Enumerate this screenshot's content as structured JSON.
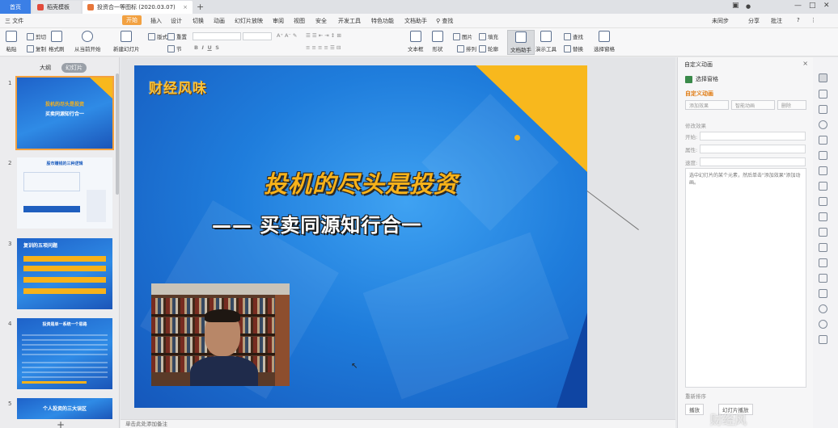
{
  "tabs": {
    "home": "首页",
    "tab1": "稻壳模板",
    "tab2": "投资合一等图标 (2020.03.07)",
    "new_tab": "+"
  },
  "menus": {
    "file": "三 文件",
    "items": [
      "开始",
      "插入",
      "设计",
      "切换",
      "动画",
      "幻灯片放映",
      "审阅",
      "视图",
      "安全",
      "开发工具",
      "特色功能",
      "文档助手"
    ],
    "search": "查找",
    "right": [
      "未同步",
      "分享",
      "批注"
    ]
  },
  "ribbon": {
    "paste": "粘贴",
    "cut": "剪切",
    "copy": "复制",
    "format_painter": "格式刷",
    "from_current": "从当前开始",
    "new_slide": "新建幻灯片",
    "layout": "版式",
    "section": "节",
    "reset": "重置",
    "textbox": "文本框",
    "shape": "形状",
    "arrange": "排列",
    "picture": "图片",
    "outline": "轮廓",
    "fill": "填充",
    "text_assist": "文档助手",
    "presenter_tools": "演示工具",
    "find": "查找",
    "replace": "替换",
    "select_pane": "选择窗格"
  },
  "leftpane": {
    "tab_outline": "大纲",
    "tab_slides": "幻灯片",
    "slides": [
      {
        "num": "1",
        "title": "投机的尽头是投资",
        "subtitle": "买卖同源知行合一"
      },
      {
        "num": "2",
        "title": "股市赚钱的三种逻辑",
        "subtitle": ""
      },
      {
        "num": "3",
        "title": "复训的五项问题",
        "subtitle": ""
      },
      {
        "num": "4",
        "title": "投资是单一系统一个思路",
        "subtitle": ""
      },
      {
        "num": "5",
        "title": "个人投资的三大误区",
        "subtitle": ""
      }
    ],
    "add": "+"
  },
  "slide": {
    "logo": "财经风味",
    "title": "投机的尽头是投资",
    "subtitle": "—— 买卖同源知行合一"
  },
  "notes": "单击此处添加备注",
  "rpanel": {
    "header": "自定义动画",
    "select_pane": "选择窗格",
    "custom_anim": "自定义动画",
    "add_effect": "添加效果",
    "smart_anim": "智能动画",
    "delete": "删除",
    "modify": "修改效果",
    "start": "开始:",
    "property": "属性:",
    "speed": "速度:",
    "hint": "选中幻灯片的某个元素，然后单击\"添加效果\"添加动画。",
    "reorder": "重新排序",
    "play": "播放",
    "slideshow": "幻灯片播放",
    "watermark": "财经风"
  },
  "colors": {
    "accent": "#f2a141",
    "slide_blue": "#1f7ddc",
    "slide_yellow": "#f7b21a"
  }
}
